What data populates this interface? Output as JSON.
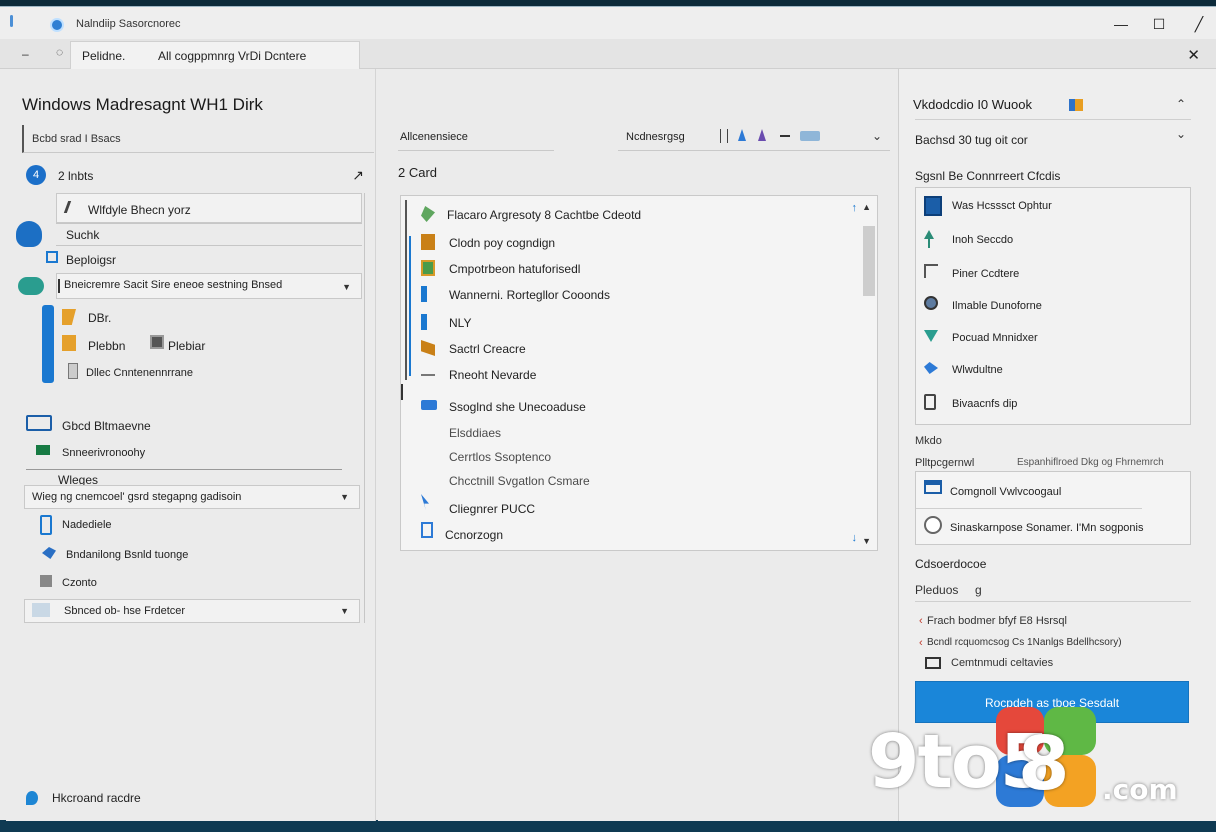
{
  "titlebar": {
    "app_title": "Nalndiip Sasorcnorec",
    "minimize": "—",
    "maximize": "☐",
    "close": "╱"
  },
  "tabbar": {
    "back": "‒",
    "nav": "◌",
    "tab_label_1": "Pelidne.",
    "tab_label_2": "All cogppmnrg VrDi Dcntere",
    "close": "✕"
  },
  "left": {
    "page_title": "Windows Madresagnt WH1 Dirk",
    "search_text": "Bcbd srad I Bsacs",
    "count_badge": "4",
    "count_label": "2 lnbts",
    "count_arrow": "↗",
    "tree": {
      "item_vehicle": "Wlfdyle Bhecn yorz",
      "item_suchk": "Suchk",
      "item_beploigsr": "Beploigsr",
      "dropdown_1": "Bneicremre Sacit Sire eneoe sestning Bnsed",
      "item_dbr": "DBr.",
      "item_plebbn": "Plebbn",
      "item_plebiar": "Plebiar",
      "item_dlec": "Dllec Cnntenennrrane",
      "item_gbcd": "Gbcd Bltmaevne",
      "item_screen": "Snneerivronoohy",
      "item_wrices": "Wleges",
      "dropdown_2": "Wieg ng cnemcoel' gsrd stegapng gadisoin",
      "item_nadedit": "Nadediele",
      "item_bndarilong": "Bndanilong Bsnld tuonge",
      "item_czonto": "Czonto",
      "dropdown_3": "Sbnced ob- hse Frdetcer"
    },
    "status": "Hkcroand racdre"
  },
  "middle": {
    "hdr_left": "Allcenensiece",
    "hdr_right": "Ncdnesrgsg",
    "mid_count": "2 Card",
    "list": [
      "Flacaro Argresoty 8 Cachtbe Cdeotd",
      "Clodn poy cogndign",
      "Cmpotrbeon hatuforisedl",
      "Wannerni. Rortegllor Cooonds",
      "NLY",
      "Sactrl Creacre",
      "Rneoht Nevarde",
      "Ssoglnd she Unecoaduse",
      "Elsddiaes",
      "Cerrtlos Ssoptenco",
      "Chcctnill Svgatlon Csmare",
      "Cliegnrer PUCC",
      "Ccnorzogn"
    ]
  },
  "right": {
    "title": "Vkdodcdio I0 Wuook",
    "chevron_up": "⌃",
    "subtitle": "Bachsd 30 tug oit cor",
    "chevron_down": "⌄",
    "section_1": "Sgsnl Be Connrreert Cfcdis",
    "items": [
      "Was Hcsssct Ophtur",
      "Inoh Seccdo",
      "Piner Ccdtere",
      "Ilmable Dunoforne",
      "Pocuad Mnnidxer",
      "Wlwdultne",
      "Bivaacnfs dip"
    ],
    "label_mkdo": "Mkdo",
    "label_pltt": "Plltpcgernwl",
    "label_pltt2": "Espanhiflroed Dkg og Fhrnemrch",
    "card_1": "Comgnoll Vwlvcoogaul",
    "card_2": "Sinaskarnpose Sonamer. I'Mn sogponis",
    "section_2": "Cdsoerdocoe",
    "section_2_sub": "Pleduos",
    "section_2_sub_tail": "g",
    "link_1": "Frach bodmer bfyf E8 Hsrsql",
    "link_2": "Bcndl rcquomcsog Cs 1Nanlgs Bdellhcsory)",
    "link_3": "Cemtnmudi celtavies",
    "primary_button": "Rocpdeh as tboe Sesdalt"
  },
  "watermark": {
    "brand_a": "9to5",
    "brand_b": "8",
    "brand_c": ".com"
  },
  "colors": {
    "accent_blue": "#1a86d9",
    "badge_blue": "#1b6fc9",
    "wm_red": "#e5483b",
    "wm_orange": "#f3a223",
    "wm_green": "#5fb845",
    "wm_blue": "#2d7ad6"
  }
}
